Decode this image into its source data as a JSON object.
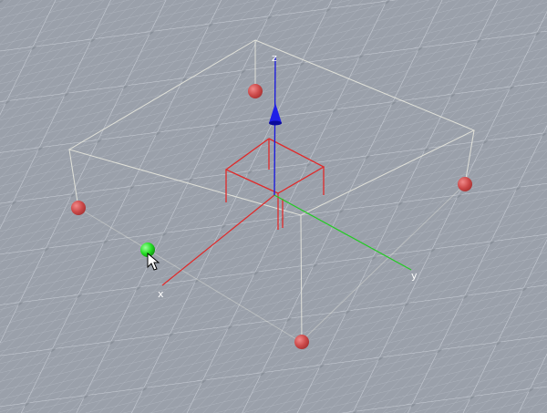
{
  "scene": {
    "axes": {
      "x": {
        "label": "x",
        "color": "#e02a2a"
      },
      "y": {
        "label": "y",
        "color": "#22cc22"
      },
      "z": {
        "label": "z",
        "color": "#1515e0"
      }
    },
    "colors": {
      "background": "#9aa0aa",
      "grid_minor": "#b6bcc5",
      "grid_major": "#c9ced6",
      "grid_dot": "#7c828c",
      "bounding_box": "#e8e8de",
      "object": "#e02a2a",
      "control_point": "#cc4a4a",
      "selected_point": "#22dd22"
    },
    "icons": {
      "cursor": "arrow-cursor-icon",
      "axis_arrow": "cone-arrow-icon"
    }
  }
}
